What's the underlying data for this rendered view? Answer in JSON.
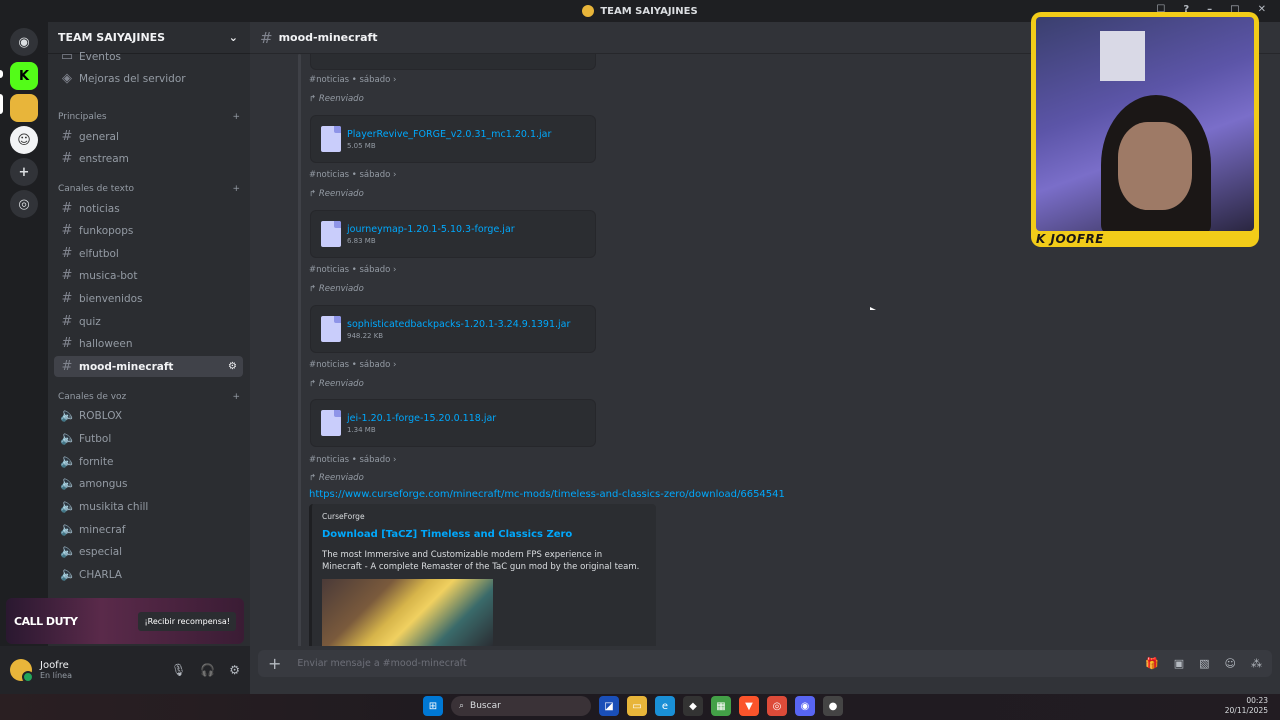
{
  "window": {
    "title": "TEAM SAIYAJINES"
  },
  "server": {
    "name": "TEAM SAIYAJINES"
  },
  "sidebar": {
    "top_items": [
      {
        "label": "Eventos"
      },
      {
        "label": "Mejoras del servidor"
      }
    ],
    "categories": [
      {
        "name": "Principales",
        "channels": [
          "general",
          "enstream"
        ]
      },
      {
        "name": "Canales de texto",
        "channels": [
          "noticias",
          "funkopops",
          "elfutbol",
          "musica-bot",
          "bienvenidos",
          "quiz",
          "halloween",
          "mood-minecraft"
        ]
      },
      {
        "name": "Canales de voz",
        "channels": [
          "ROBLOX",
          "Futbol",
          "fornite",
          "amongus",
          "musikita chill",
          "minecraf",
          "especial",
          "CHARLA"
        ]
      }
    ],
    "active_channel": "mood-minecraft"
  },
  "promo": {
    "brand": "CALL DUTY",
    "button": "¡Recibir recompensa!"
  },
  "user": {
    "name": "Joofre",
    "status": "En línea"
  },
  "channel": {
    "name": "mood-minecraft"
  },
  "messages": {
    "source": "#noticias",
    "day": "sábado",
    "forwarded_label": "Reenviado",
    "files": [
      {
        "name": "PlayerRevive_FORGE_v2.0.31_mc1.20.1.jar",
        "size": "5.05 MB"
      },
      {
        "name": "journeymap-1.20.1-5.10.3-forge.jar",
        "size": "6.83 MB"
      },
      {
        "name": "sophisticatedbackpacks-1.20.1-3.24.9.1391.jar",
        "size": "948.22 KB"
      },
      {
        "name": "jei-1.20.1-forge-15.20.0.118.jar",
        "size": "1.34 MB"
      }
    ],
    "link": "https://www.curseforge.com/minecraft/mc-mods/timeless-and-classics-zero/download/6654541",
    "embed": {
      "provider": "CurseForge",
      "title": "Download [TaCZ] Timeless and Classics Zero",
      "description": "The most Immersive and Customizable modern FPS experience in Minecraft - A complete Remaster of the TaC gun mod by the original team."
    }
  },
  "composer": {
    "placeholder": "Enviar mensaje a #mood-minecraft"
  },
  "webcam": {
    "name": "K JOOFRE"
  },
  "taskbar": {
    "search": "Buscar",
    "time": "00:23",
    "date": "20/11/2025"
  },
  "colors": {
    "accent": "#5865f2",
    "link": "#00a8fc",
    "webcam_border": "#f2cc19"
  }
}
